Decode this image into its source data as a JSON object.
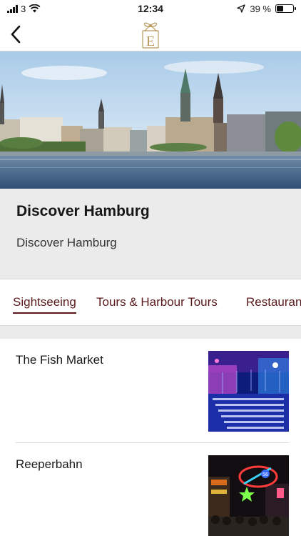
{
  "status_bar": {
    "carrier_signal": "3",
    "time": "12:34",
    "battery_text": "39 %",
    "battery_level": 0.39,
    "icons": [
      "signal-bars-icon",
      "wifi-icon",
      "location-arrow-icon",
      "battery-icon"
    ]
  },
  "nav": {
    "back_icon": "chevron-left-icon",
    "logo_letter": "E"
  },
  "header": {
    "title": "Discover Hamburg",
    "subtitle": "Discover Hamburg"
  },
  "tabs": [
    {
      "label": "Sightseeing",
      "active": true
    },
    {
      "label": "Tours & Harbour Tours",
      "active": false
    },
    {
      "label": "Restaurants",
      "active": false
    }
  ],
  "items": [
    {
      "title": "The Fish Market"
    },
    {
      "title": "Reeperbahn"
    }
  ],
  "colors": {
    "accent": "#5a1a1c",
    "gold": "#b89a5c",
    "panel_bg": "#ebebeb"
  }
}
